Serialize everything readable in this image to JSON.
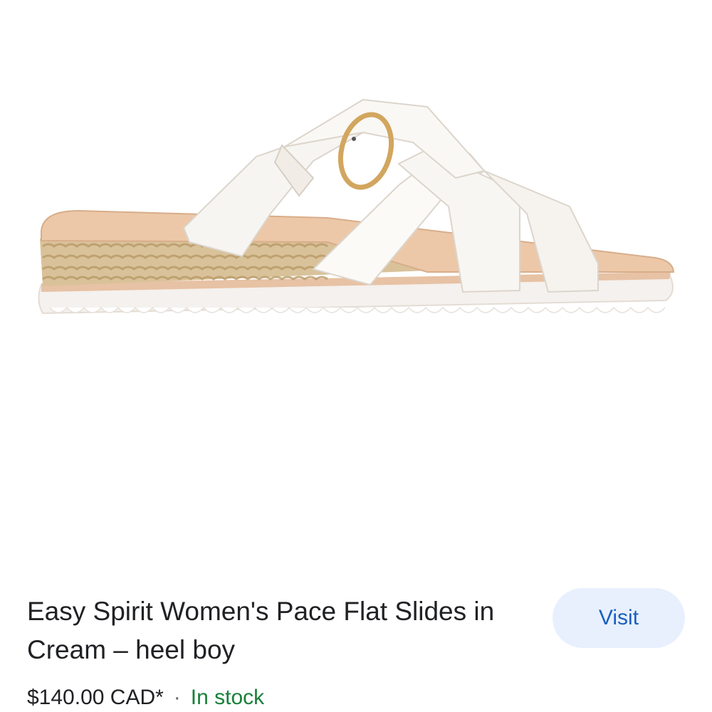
{
  "product": {
    "title": "Easy Spirit Women's Pace Flat Slides in Cream – heel boy",
    "price": "$140.00 CAD*",
    "separator": "·",
    "stock_status": "In stock",
    "image_icon": "sandal-product-image"
  },
  "actions": {
    "visit_label": "Visit"
  },
  "colors": {
    "stock_green": "#188038",
    "button_bg": "#e8f0fe",
    "button_text": "#1a5fbf"
  }
}
